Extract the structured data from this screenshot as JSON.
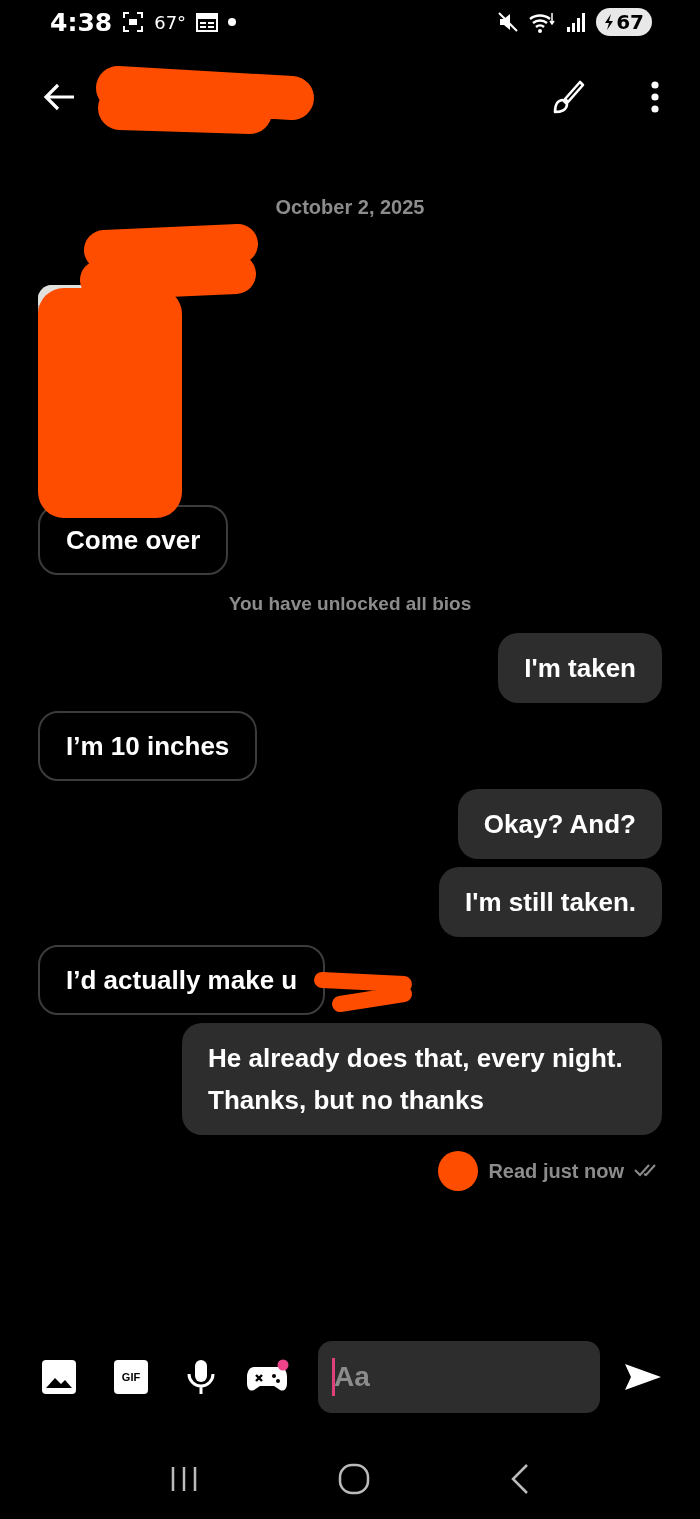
{
  "status_bar": {
    "time": "4:38",
    "temperature": "67°",
    "battery": "67"
  },
  "date": "October 2, 2025",
  "messages": [
    {
      "kind": "picture"
    },
    {
      "kind": "incoming",
      "text": "Come over"
    },
    {
      "kind": "notice",
      "text": "You have unlocked all bios"
    },
    {
      "kind": "outgoing",
      "text": "I'm taken"
    },
    {
      "kind": "incoming",
      "text": "I’m 10 inches"
    },
    {
      "kind": "outgoing",
      "text": "Okay? And?"
    },
    {
      "kind": "outgoing",
      "text": "I'm still taken."
    },
    {
      "kind": "incoming",
      "text": "I’d actually make u"
    },
    {
      "kind": "outgoing",
      "text": "He already does that, every night. Thanks, but no thanks"
    }
  ],
  "read_receipt": "Read just now",
  "composer": {
    "gif_label": "GIF",
    "placeholder": "Aa",
    "has_game_alert": true
  }
}
